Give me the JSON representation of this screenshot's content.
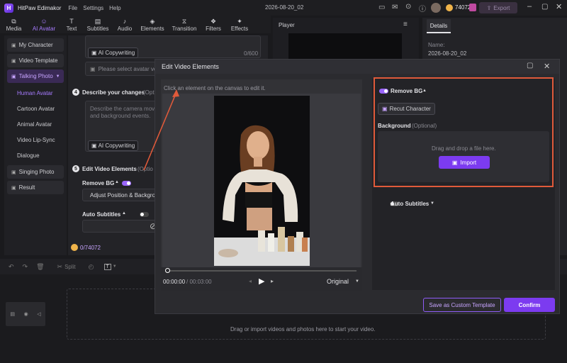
{
  "app": {
    "title": "HitPaw Edimakor",
    "menu": [
      "File",
      "Settings",
      "Help"
    ],
    "project_name": "2026-08-20_02",
    "credits": "74072",
    "export_label": "Export"
  },
  "toolbar": {
    "items": [
      {
        "label": "Media",
        "icon": "media-icon"
      },
      {
        "label": "AI Avatar",
        "icon": "ai-avatar-icon"
      },
      {
        "label": "Text",
        "icon": "text-icon"
      },
      {
        "label": "Subtitles",
        "icon": "subtitles-icon"
      },
      {
        "label": "Audio",
        "icon": "audio-icon"
      },
      {
        "label": "Elements",
        "icon": "elements-icon"
      },
      {
        "label": "Transition",
        "icon": "transition-icon"
      },
      {
        "label": "Filters",
        "icon": "filters-icon"
      },
      {
        "label": "Effects",
        "icon": "effects-icon"
      }
    ]
  },
  "sidebar": {
    "items": [
      "My Character",
      "Video Template",
      "Talking Photo",
      "Singing Photo",
      "Result"
    ],
    "sub_items": [
      "Human Avatar",
      "Cartoon Avatar",
      "Animal Avatar",
      "Video Lip-Sync",
      "Dialogue"
    ]
  },
  "mid": {
    "counter1": "0/600",
    "ai_copywriting": "AI Copywriting",
    "avatar_placeholder": "Please select avatar vo",
    "step4": "Describe your changes",
    "step4_opt": "(Opt",
    "describe_text": "Describe the camera mov and background events.",
    "step5": "Edit Video Elements",
    "step5_opt": "(Optio",
    "remove_bg": "Remove BG",
    "adjust": "Adjust Position & Backgro",
    "auto_subtitles": "Auto Subtitles",
    "credit_cost": "0/74072"
  },
  "player": {
    "title": "Player"
  },
  "details": {
    "tab": "Details",
    "name_label": "Name:",
    "name_value": "2026-08-20_02"
  },
  "timeline": {
    "split": "Split",
    "drop_text": "Drag or import videos and photos here to start your video."
  },
  "dialog": {
    "title": "Edit Video Elements",
    "hint": "Click an element on the canvas to edit it.",
    "time_current": "00:00:00",
    "time_total": "/ 00:03:00",
    "ratio": "Original",
    "remove_bg": "Remove BG",
    "recut": "Recut Character",
    "background": "Background",
    "background_opt": "(Optional)",
    "drop_hint": "Drag and drop a file here.",
    "import": "Import",
    "auto_subtitles": "Auto Subtitles",
    "save_template": "Save as Custom Template",
    "confirm": "Confirm"
  },
  "colors": {
    "accent": "#7c3bf0",
    "highlight": "#e05a3a"
  }
}
